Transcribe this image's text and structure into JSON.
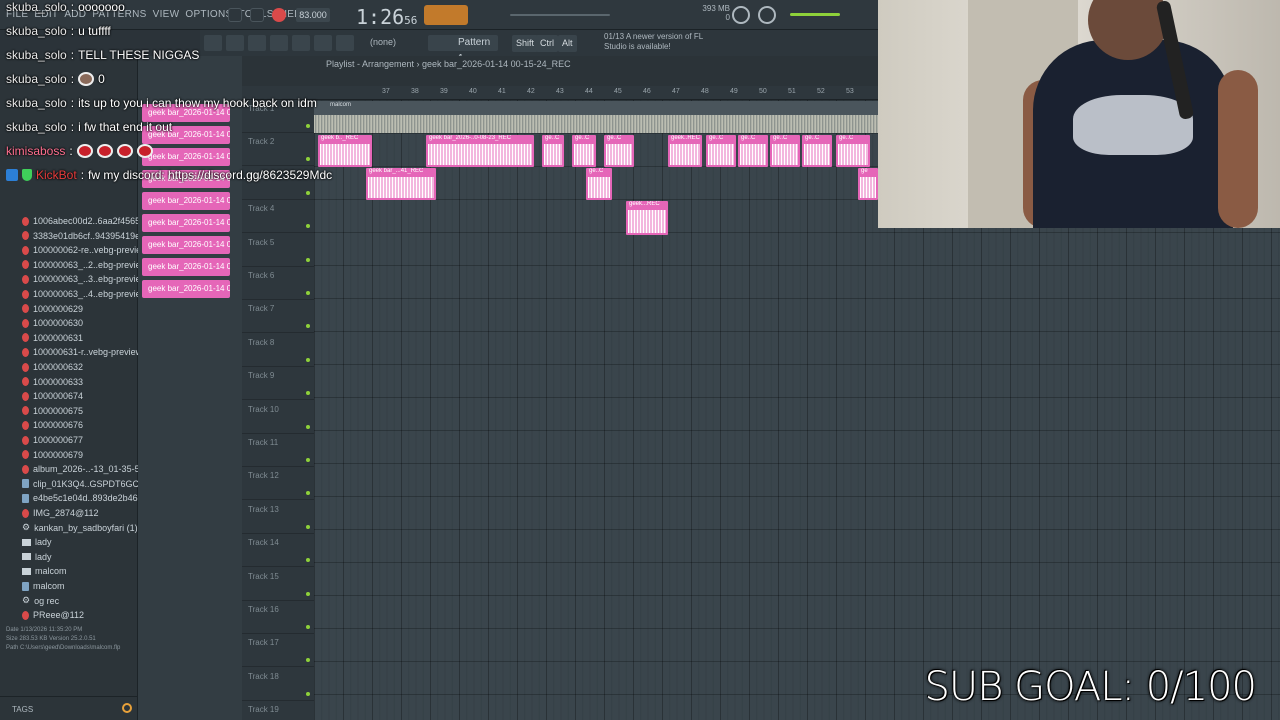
{
  "app": {
    "menus": [
      "FILE",
      "EDIT",
      "ADD",
      "PATTERNS",
      "VIEW",
      "OPTIONS",
      "TOOLS",
      "HELP"
    ],
    "time": "1:26",
    "time_small": "56",
    "tempo": "83.000",
    "memory": "393 MB",
    "memory2": "0",
    "playlist_title": "Playlist - Arrangement › geek bar_2026-01-14 00-15-24_REC",
    "pattern_label": "Pattern 1",
    "none_label": "(none)",
    "shift": "Shift",
    "ctrl": "Ctrl",
    "alt": "Alt",
    "news_date": "01/13",
    "news_text": "A newer version of FL Studio is available!"
  },
  "browser": {
    "files": [
      {
        "name": "1006abec00d2..6aa2f4565b6",
        "icon": "audio"
      },
      {
        "name": "3383e01db6cf..94395419e87",
        "icon": "audio"
      },
      {
        "name": "100000062-re..vebg-preview",
        "icon": "audio"
      },
      {
        "name": "100000063_..2..ebg-preview",
        "icon": "audio"
      },
      {
        "name": "100000063_..3..ebg-preview",
        "icon": "audio"
      },
      {
        "name": "100000063_..4..ebg-preview",
        "icon": "audio"
      },
      {
        "name": "1000000629",
        "icon": "audio"
      },
      {
        "name": "1000000630",
        "icon": "audio"
      },
      {
        "name": "1000000631",
        "icon": "audio"
      },
      {
        "name": "100000631-r..vebg-preview",
        "icon": "audio"
      },
      {
        "name": "1000000632",
        "icon": "audio"
      },
      {
        "name": "1000000633",
        "icon": "audio"
      },
      {
        "name": "1000000674",
        "icon": "audio"
      },
      {
        "name": "1000000675",
        "icon": "audio"
      },
      {
        "name": "1000000676",
        "icon": "audio"
      },
      {
        "name": "1000000677",
        "icon": "audio"
      },
      {
        "name": "1000000679",
        "icon": "audio"
      },
      {
        "name": "album_2026-..-13_01-35-58",
        "icon": "audio"
      },
      {
        "name": "clip_01K3Q4..GSPDT6GC7MA",
        "icon": "image"
      },
      {
        "name": "e4be5c1e04d..893de2b462c",
        "icon": "image"
      },
      {
        "name": "IMG_2874@112",
        "icon": "audio"
      },
      {
        "name": "kankan_by_sadboyfari (1)",
        "icon": "gear"
      },
      {
        "name": "lady",
        "icon": "folder"
      },
      {
        "name": "lady",
        "icon": "folder"
      },
      {
        "name": "malcom",
        "icon": "folder-open"
      },
      {
        "name": "malcom",
        "icon": "image"
      },
      {
        "name": "og rec",
        "icon": "gear"
      },
      {
        "name": "PReee@112",
        "icon": "audio"
      }
    ],
    "info": {
      "date_label": "Date",
      "date": "1/13/2026 11:35:20 PM",
      "size_label": "Size",
      "size": "283.53 KB",
      "version_label": "Version",
      "version": "25.2.0.51",
      "path_label": "Path",
      "path": "C:\\Users\\geed\\Downloads\\malcom.flp"
    },
    "tags_label": "TAGS"
  },
  "patterns": [
    "geek bar_2026-01-14 00",
    "geek bar_2026-01-14 00",
    "geek bar_2026-01-14 00",
    "geek bar_2026-01-14 00",
    "geek bar_2026-01-14 00",
    "geek bar_2026-01-14 00",
    "geek bar_2026-01-14 00",
    "geek bar_2026-01-14 00",
    "geek bar_2026-01-14 00"
  ],
  "ruler": [
    "37",
    "38",
    "39",
    "40",
    "41",
    "42",
    "43",
    "44",
    "45",
    "46",
    "47",
    "48",
    "49",
    "50",
    "51",
    "52",
    "53"
  ],
  "tracks": [
    "Track 1",
    "Track 2",
    "Track 3",
    "Track 4",
    "Track 5",
    "Track 6",
    "Track 7",
    "Track 8",
    "Track 9",
    "Track 10",
    "Track 11",
    "Track 12",
    "Track 13",
    "Track 14",
    "Track 15",
    "Track 16",
    "Track 17",
    "Track 18",
    "Track 19"
  ],
  "audio_clip_label": "malcom",
  "clip_labels": {
    "c1": "geek b.._REC",
    "c2": "geek bar_2026-..0-08-23_REC",
    "c3": "ge..C",
    "c4": "ge..C",
    "c5": "ge..C",
    "c6": "geek..REC",
    "c7": "ge..C",
    "c8": "ge..C",
    "c9": "ge..C",
    "c10": "ge..C",
    "c11": "ge..C",
    "c12": "geek bar_...41_REC",
    "c13": "ge..C",
    "c14": "geek...REC",
    "c15": "ge"
  },
  "chat": [
    {
      "user": "skuba_solo",
      "text": "ooooooo"
    },
    {
      "user": "skuba_solo",
      "text": "u tuffff"
    },
    {
      "user": "skuba_solo",
      "text": "TELL THESE NIGGAS"
    },
    {
      "user": "skuba_solo",
      "text": "0"
    },
    {
      "user": "skuba_solo",
      "text": "its up to you i can thow my hook back on idm"
    },
    {
      "user": "skuba_solo",
      "text": "i fw that end it out"
    },
    {
      "user": "kimisaboss",
      "text": ""
    },
    {
      "user": "KickBot",
      "text": "fw my discord: https://discord.gg/8623529Mdc"
    }
  ],
  "sub_goal": "SUB GOAL: 0/100"
}
